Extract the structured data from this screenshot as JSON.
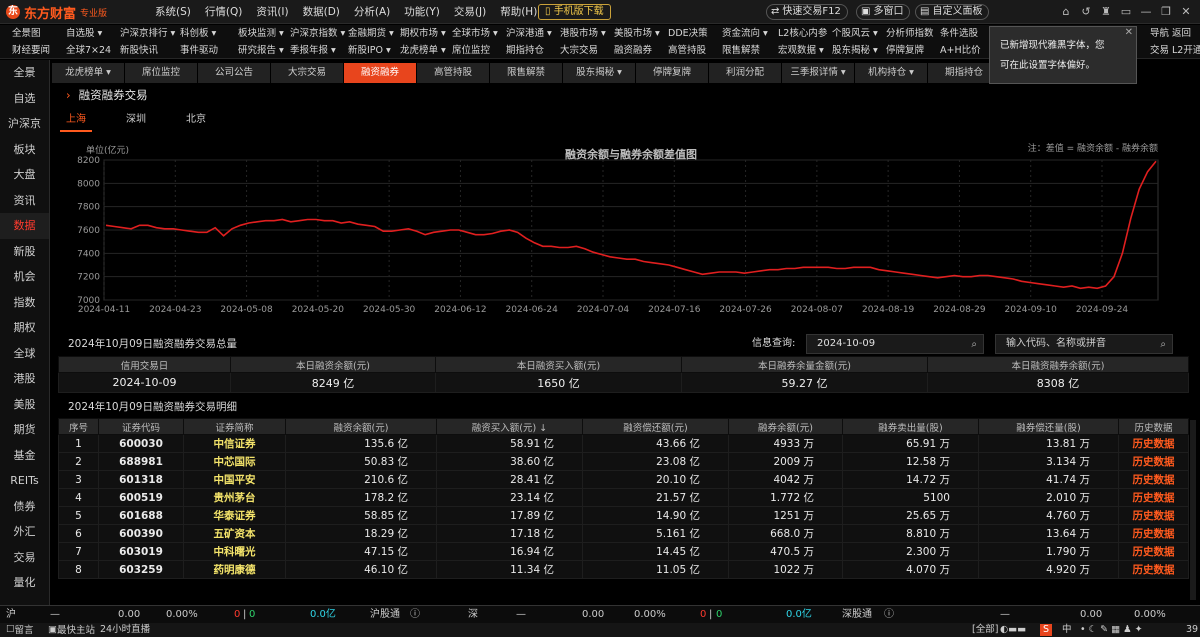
{
  "app": {
    "logo_mark": "东",
    "name": "东方财富",
    "edition": "专业版"
  },
  "main_menu": [
    "系统(S)",
    "行情(Q)",
    "资讯(I)",
    "数据(D)",
    "分析(A)",
    "功能(Y)",
    "交易(J)",
    "帮助(H)"
  ],
  "mobile_download": "手机版下载",
  "top_buttons": {
    "quick_trade": "快速交易F12",
    "multi_window": "多窗口",
    "custom_panel": "自定义面板"
  },
  "toolbar_cols": [
    [
      "全景图",
      "财经要闻"
    ],
    [
      "自选股 ▾",
      "全球7×24"
    ],
    [
      "沪深京排行 ▾",
      "新股快讯"
    ],
    [
      "科创板 ▾",
      "事件驱动"
    ],
    [
      "板块监测 ▾",
      "研究报告 ▾"
    ],
    [
      "沪深京指数 ▾",
      "季报年报 ▾"
    ],
    [
      "金融期货 ▾",
      "新股IPO ▾"
    ],
    [
      "期权市场 ▾",
      "龙虎榜单 ▾"
    ],
    [
      "全球市场 ▾",
      "席位监控"
    ],
    [
      "沪深港通 ▾",
      "期指持仓"
    ],
    [
      "港股市场 ▾",
      "大宗交易"
    ],
    [
      "美股市场 ▾",
      "融资融券"
    ],
    [
      "DDE决策",
      "高管持股"
    ],
    [
      "资金流向 ▾",
      "限售解禁"
    ],
    [
      "L2核心内参",
      "宏观数据 ▾"
    ],
    [
      "个股风云 ▾",
      "股东揭秘 ▾"
    ],
    [
      "分析师指数",
      "停牌复牌"
    ],
    [
      "条件选股",
      "A+H比价"
    ],
    [
      "",
      "利润分配"
    ],
    [
      "",
      "三季报"
    ],
    [
      "导航",
      "交易"
    ],
    [
      "返回",
      "L2开通"
    ]
  ],
  "tooltip": {
    "line1": "已新增现代雅黑字体，您",
    "line2": "可在此设置字体偏好。"
  },
  "sidebar": [
    "全景",
    "自选",
    "沪深京",
    "板块",
    "大盘",
    "资讯",
    "数据",
    "新股",
    "机会",
    "指数",
    "期权",
    "全球",
    "港股",
    "美股",
    "期货",
    "基金",
    "REITs",
    "债券",
    "外汇",
    "交易",
    "量化"
  ],
  "sidebar_active": 6,
  "subtabs": [
    "龙虎榜单 ▾",
    "席位监控",
    "公司公告",
    "大宗交易",
    "融资融券",
    "高管持股",
    "限售解禁",
    "股东揭秘 ▾",
    "停牌复牌",
    "利润分配",
    "三季报详情 ▾",
    "机构持仓 ▾",
    "期指持仓",
    "宏观数"
  ],
  "subtab_active": 4,
  "page_title": "融资融券交易",
  "market_tabs": [
    "上海",
    "深圳",
    "北京"
  ],
  "market_active": 0,
  "chart_data": {
    "type": "line",
    "title": "融资余额与融券余额差值图",
    "ylabel": "单位(亿元)",
    "note": "注：差值 = 融资余额 - 融券余额",
    "ylim": [
      7000,
      8200
    ],
    "yticks": [
      7000,
      7200,
      7400,
      7600,
      7800,
      8000,
      8200
    ],
    "xticks": [
      "2024-04-11",
      "2024-04-23",
      "2024-05-08",
      "2024-05-20",
      "2024-05-30",
      "2024-06-12",
      "2024-06-24",
      "2024-07-04",
      "2024-07-16",
      "2024-07-26",
      "2024-08-07",
      "2024-08-19",
      "2024-08-29",
      "2024-09-10",
      "2024-09-24"
    ],
    "values": [
      7640,
      7630,
      7620,
      7610,
      7640,
      7640,
      7620,
      7610,
      7610,
      7600,
      7590,
      7580,
      7580,
      7620,
      7550,
      7610,
      7640,
      7660,
      7670,
      7680,
      7680,
      7690,
      7670,
      7680,
      7690,
      7690,
      7680,
      7680,
      7660,
      7670,
      7650,
      7640,
      7630,
      7590,
      7590,
      7600,
      7610,
      7590,
      7560,
      7580,
      7590,
      7600,
      7600,
      7580,
      7560,
      7560,
      7570,
      7590,
      7600,
      7580,
      7530,
      7490,
      7460,
      7460,
      7450,
      7450,
      7460,
      7440,
      7410,
      7390,
      7370,
      7360,
      7350,
      7350,
      7330,
      7320,
      7310,
      7300,
      7280,
      7260,
      7240,
      7220,
      7230,
      7240,
      7240,
      7240,
      7230,
      7240,
      7250,
      7260,
      7260,
      7270,
      7270,
      7280,
      7280,
      7280,
      7280,
      7270,
      7270,
      7280,
      7280,
      7280,
      7260,
      7250,
      7240,
      7230,
      7220,
      7210,
      7200,
      7190,
      7200,
      7210,
      7200,
      7200,
      7210,
      7210,
      7200,
      7190,
      7180,
      7160,
      7150,
      7140,
      7130,
      7120,
      7110,
      7120,
      7100,
      7110,
      7100,
      7120,
      7200,
      7400,
      7700,
      7950,
      8100,
      8190
    ],
    "color": "#e01f1f"
  },
  "summary": {
    "title": "2024年10月09日融资融券交易总量",
    "headers": [
      "信用交易日",
      "本日融资余额(元)",
      "本日融资买入额(元)",
      "本日融券余量金额(元)",
      "本日融资融券余额(元)"
    ],
    "values": [
      "2024-10-09",
      "8249 亿",
      "1650 亿",
      "59.27 亿",
      "8308 亿"
    ]
  },
  "query": {
    "label": "信息查询:",
    "date": "2024-10-09",
    "search_placeholder": "输入代码、名称或拼音"
  },
  "detail": {
    "title": "2024年10月09日融资融券交易明细",
    "headers": [
      "序号",
      "证券代码",
      "证券简称",
      "融资余额(元)",
      "融资买入额(元) ↓",
      "融资偿还额(元)",
      "融券余额(元)",
      "融券卖出量(股)",
      "融券偿还量(股)",
      "历史数据"
    ],
    "rows": [
      [
        "1",
        "600030",
        "中信证券",
        "135.6 亿",
        "58.91 亿",
        "43.66 亿",
        "4933 万",
        "65.91 万",
        "13.81 万",
        "历史数据"
      ],
      [
        "2",
        "688981",
        "中芯国际",
        "50.83 亿",
        "38.60 亿",
        "23.08 亿",
        "2009 万",
        "12.58 万",
        "3.134 万",
        "历史数据"
      ],
      [
        "3",
        "601318",
        "中国平安",
        "210.6 亿",
        "28.41 亿",
        "20.10 亿",
        "4042 万",
        "14.72 万",
        "41.74 万",
        "历史数据"
      ],
      [
        "4",
        "600519",
        "贵州茅台",
        "178.2 亿",
        "23.14 亿",
        "21.57 亿",
        "1.772 亿",
        "5100",
        "2.010 万",
        "历史数据"
      ],
      [
        "5",
        "601688",
        "华泰证券",
        "58.85 亿",
        "17.89 亿",
        "14.90 亿",
        "1251 万",
        "25.65 万",
        "4.760 万",
        "历史数据"
      ],
      [
        "6",
        "600390",
        "五矿资本",
        "18.29 亿",
        "17.18 亿",
        "5.161 亿",
        "668.0 万",
        "8.810 万",
        "13.64 万",
        "历史数据"
      ],
      [
        "7",
        "603019",
        "中科曙光",
        "47.15 亿",
        "16.94 亿",
        "14.45 亿",
        "470.5 万",
        "2.300 万",
        "1.790 万",
        "历史数据"
      ],
      [
        "8",
        "603259",
        "药明康德",
        "46.10 亿",
        "11.34 亿",
        "11.05 亿",
        "1022 万",
        "4.070 万",
        "4.920 万",
        "历史数据"
      ]
    ]
  },
  "statusbar": {
    "sh": "沪",
    "sh_dash": "—",
    "sh_val": "0.00",
    "sh_pct": "0.00%",
    "sh_r": "0",
    "sh_g": "0",
    "sh_amt": "0.0亿",
    "hgt": "沪股通",
    "sz": "深",
    "sz_dash": "—",
    "sz_val": "0.00",
    "sz_pct": "0.00%",
    "sz_r": "0",
    "sz_g": "0",
    "sz_amt": "0.0亿",
    "sgt": "深股通",
    "dash2": "—",
    "v3": "0.00",
    "p3": "0.00%"
  },
  "bottombar": {
    "msg": "留言",
    "fast": "最快主站",
    "live": "24小时直播",
    "all": "[全部]",
    "num": "39",
    "ime": "中"
  }
}
